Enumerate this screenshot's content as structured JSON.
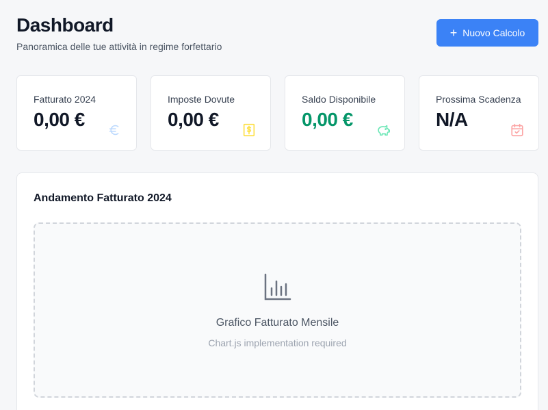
{
  "header": {
    "title": "Dashboard",
    "subtitle": "Panoramica delle tue attività in regime forfettario",
    "new_button_label": "Nuovo Calcolo"
  },
  "stats": [
    {
      "label": "Fatturato 2024",
      "value": "0,00 €",
      "icon": "euro-icon",
      "icon_color": "#bfdbfe"
    },
    {
      "label": "Imposte Dovute",
      "value": "0,00 €",
      "icon": "receipt-dollar-icon",
      "icon_color": "#fde047"
    },
    {
      "label": "Saldo Disponibile",
      "value": "0,00 €",
      "icon": "piggy-bank-icon",
      "icon_color": "#6ee7b7",
      "value_color": "#059669"
    },
    {
      "label": "Prossima Scadenza",
      "value": "N/A",
      "icon": "calendar-check-icon",
      "icon_color": "#fca5a5"
    }
  ],
  "chart_panel": {
    "title": "Andamento Fatturato 2024",
    "placeholder_title": "Grafico Fatturato Mensile",
    "placeholder_note": "Chart.js implementation required",
    "icon": "bar-chart-icon"
  },
  "colors": {
    "accent": "#3b82f6",
    "positive": "#059669"
  }
}
